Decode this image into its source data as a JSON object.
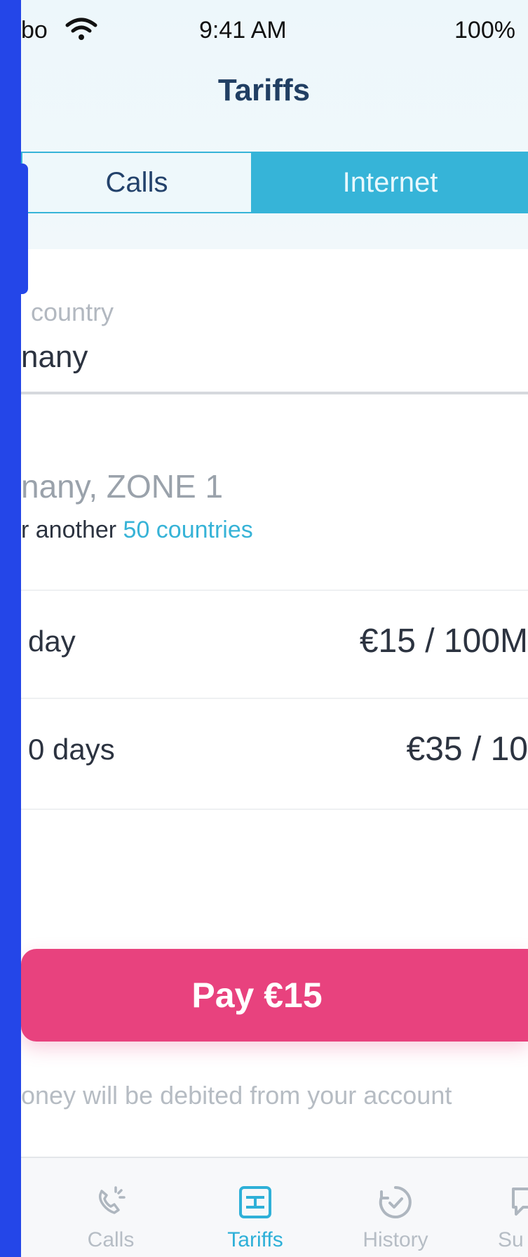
{
  "status_bar": {
    "carrier": "bo",
    "time": "9:41 AM",
    "battery": "100%"
  },
  "header": {
    "title": "Tariffs",
    "segments": [
      {
        "label": "Calls",
        "active": false
      },
      {
        "label": "Internet",
        "active": true
      }
    ]
  },
  "country_field": {
    "label": "country",
    "value": "nany"
  },
  "zone": {
    "title": "nany, ZONE 1",
    "subtitle_prefix": "r another",
    "subtitle_link": "50 countries"
  },
  "plans": [
    {
      "label": "day",
      "price": "€15 / 100M"
    },
    {
      "label": "0 days",
      "price": "€35 / 10"
    }
  ],
  "pay": {
    "button_label": "Pay €15",
    "note": "oney will be debited from your account"
  },
  "tabbar": {
    "items": [
      {
        "label": "Calls",
        "icon": "phone-calling-icon"
      },
      {
        "label": "Tariffs",
        "icon": "tariffs-icon",
        "active": true
      },
      {
        "label": "History",
        "icon": "history-clock-icon"
      },
      {
        "label": "Su",
        "icon": "support-chat-icon"
      }
    ]
  },
  "colors": {
    "accent_blue": "#36b4d8",
    "pay_pink": "#e8427e",
    "title_navy": "#213f63",
    "edge_blue": "#2446E8"
  }
}
